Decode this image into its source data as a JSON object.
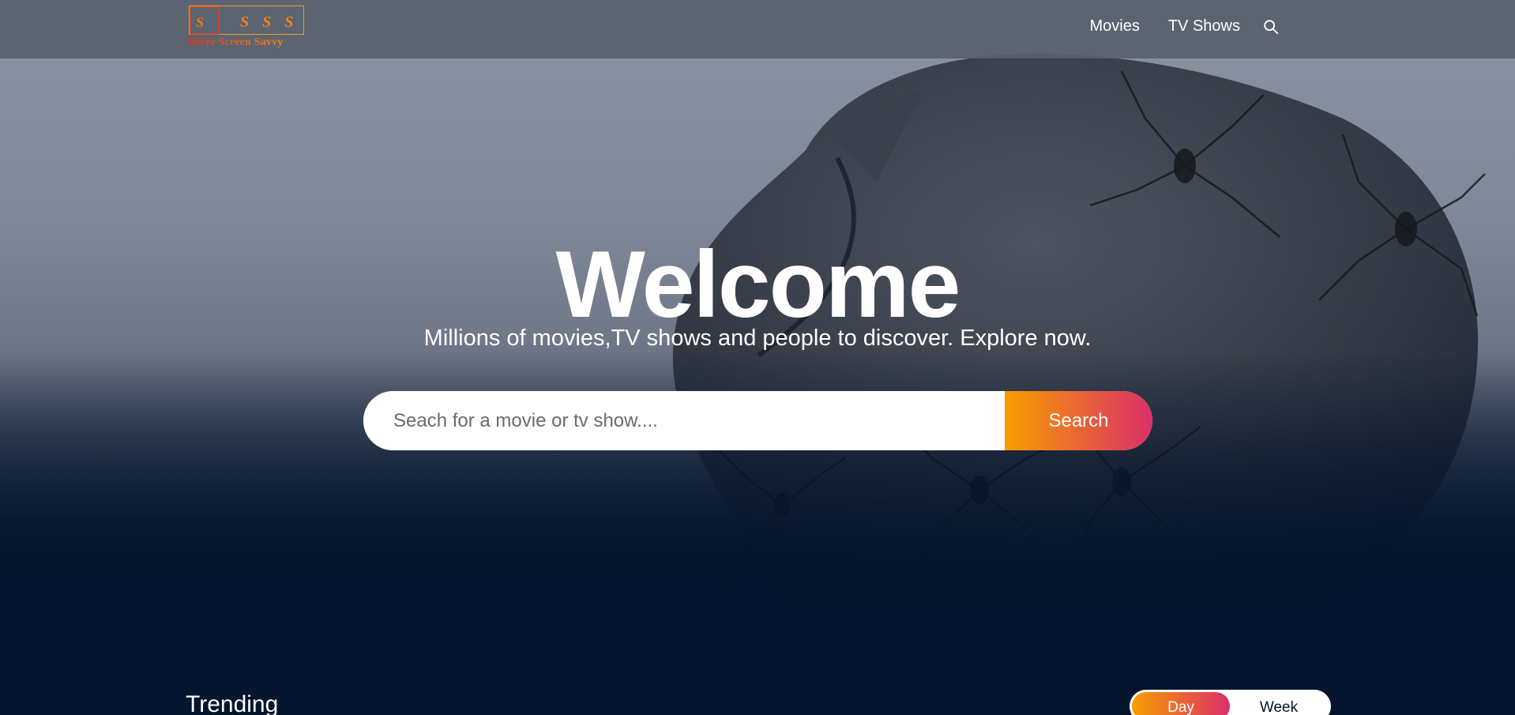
{
  "header": {
    "logo_text": "Silver Screen Savvy",
    "logo_glyphs": "S S S",
    "nav": [
      {
        "label": "Movies"
      },
      {
        "label": "TV Shows"
      }
    ],
    "search_icon": "search-icon"
  },
  "hero": {
    "title": "Welcome",
    "subtitle": "Millions of movies,TV shows and people to discover. Explore now.",
    "search": {
      "placeholder": "Seach for a movie or tv show....",
      "value": "",
      "button_label": "Search"
    }
  },
  "trending": {
    "title": "Trending",
    "tabs": [
      {
        "label": "Day",
        "active": true
      },
      {
        "label": "Week",
        "active": false
      }
    ]
  },
  "colors": {
    "accent_start": "#f89e00",
    "accent_end": "#da2f68",
    "background": "#04152d",
    "header": "#585f6c"
  }
}
